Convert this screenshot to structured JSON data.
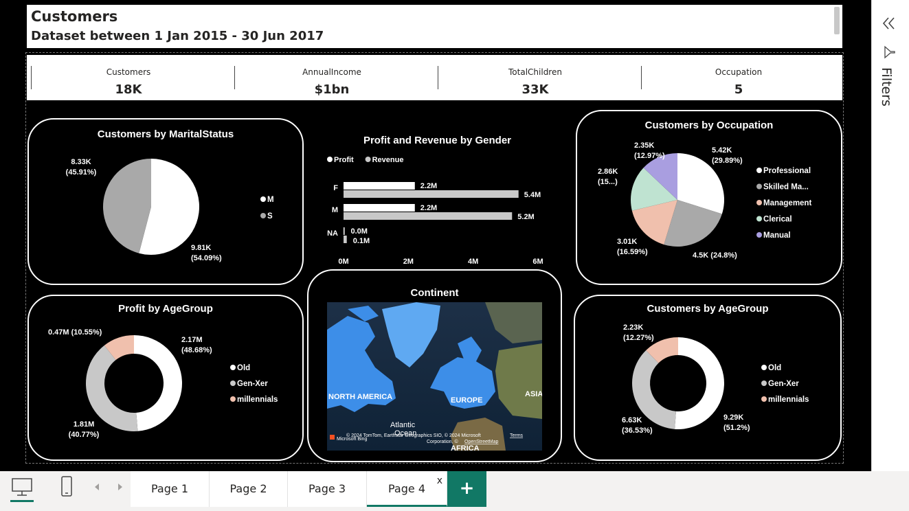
{
  "header": {
    "title": "Customers",
    "subtitle": "Dataset between 1 Jan 2015 - 30 Jun 2017"
  },
  "kpis": [
    {
      "label": "Customers",
      "value": "18K"
    },
    {
      "label": "AnnualIncome",
      "value": "$1bn"
    },
    {
      "label": "TotalChildren",
      "value": "33K"
    },
    {
      "label": "Occupation",
      "value": "5"
    }
  ],
  "filters": {
    "label": "Filters",
    "collapse_icon": "double-chevron-left-icon",
    "funnel_icon": "filter-funnel-icon"
  },
  "colors": {
    "white": "#ffffff",
    "gray": "#a9a9a9",
    "lightgray": "#c8c8c8",
    "peach": "#f0c0ad",
    "mint": "#bfe3d1",
    "lavender": "#a99ee0",
    "accent": "#117865"
  },
  "chart_data": [
    {
      "id": "marital",
      "type": "pie",
      "title": "Customers by MaritalStatus",
      "categories": [
        "M",
        "S"
      ],
      "values": [
        9810,
        8330
      ],
      "labels": [
        {
          "value": "9.81K",
          "pct": "(54.09%)"
        },
        {
          "value": "8.33K",
          "pct": "(45.91%)"
        }
      ],
      "colors": [
        "#ffffff",
        "#a9a9a9"
      ],
      "legend": "right"
    },
    {
      "id": "gender",
      "type": "bar",
      "title": "Profit and Revenue by Gender",
      "categories": [
        "F",
        "M",
        "NA"
      ],
      "series": [
        {
          "name": "Profit",
          "values": [
            2.2,
            2.2,
            0.0
          ],
          "labels": [
            "2.2M",
            "2.2M",
            "0.0M"
          ]
        },
        {
          "name": "Revenue",
          "values": [
            5.4,
            5.2,
            0.1
          ],
          "labels": [
            "5.4M",
            "5.2M",
            "0.1M"
          ]
        }
      ],
      "xticks": [
        "0M",
        "2M",
        "4M",
        "6M"
      ],
      "xlim": [
        0,
        6
      ],
      "legend": "top-left"
    },
    {
      "id": "occupation",
      "type": "pie",
      "title": "Customers by Occupation",
      "categories": [
        "Professional",
        "Skilled Ma...",
        "Management",
        "Clerical",
        "Manual"
      ],
      "values": [
        5420,
        4500,
        3010,
        2860,
        2350
      ],
      "labels": [
        {
          "value": "5.42K",
          "pct": "(29.89%)"
        },
        {
          "value": "4.5K (24.8%)",
          "pct": ""
        },
        {
          "value": "3.01K",
          "pct": "(16.59%)"
        },
        {
          "value": "2.86K",
          "pct": "(15...)"
        },
        {
          "value": "2.35K",
          "pct": "(12.97%)"
        }
      ],
      "colors": [
        "#ffffff",
        "#a9a9a9",
        "#f0c0ad",
        "#bfe3d1",
        "#a99ee0"
      ],
      "legend": "right"
    },
    {
      "id": "profit_age",
      "type": "pie",
      "title": "Profit by AgeGroup",
      "categories": [
        "Old",
        "Gen-Xer",
        "millennials"
      ],
      "values": [
        2.17,
        1.81,
        0.47
      ],
      "labels": [
        {
          "value": "2.17M",
          "pct": "(48.68%)"
        },
        {
          "value": "1.81M",
          "pct": "(40.77%)"
        },
        {
          "value": "0.47M (10.55%)",
          "pct": ""
        }
      ],
      "colors": [
        "#ffffff",
        "#c8c8c8",
        "#f0c0ad"
      ],
      "donut": true,
      "legend": "right"
    },
    {
      "id": "cust_age",
      "type": "pie",
      "title": "Customers by AgeGroup",
      "categories": [
        "Old",
        "Gen-Xer",
        "millennials"
      ],
      "values": [
        9290,
        6630,
        2230
      ],
      "labels": [
        {
          "value": "9.29K",
          "pct": "(51.2%)"
        },
        {
          "value": "6.63K",
          "pct": "(36.53%)"
        },
        {
          "value": "2.23K",
          "pct": "(12.27%)"
        }
      ],
      "colors": [
        "#ffffff",
        "#c8c8c8",
        "#f0c0ad"
      ],
      "donut": true,
      "legend": "right"
    }
  ],
  "map": {
    "title": "Continent",
    "labels": [
      "NORTH AMERICA",
      "EUROPE",
      "ASIA",
      "Atlantic",
      "Ocean",
      "AFRICA"
    ],
    "logo": "Microsoft Bing",
    "attribution": "© 2024 TomTom, Earthstar Geographics SIO, © 2024 Microsoft",
    "terms": "Terms",
    "corporation": "Corporation, ©",
    "osm": "OpenStreetMap"
  },
  "tabs": {
    "items": [
      "Page 1",
      "Page 2",
      "Page 3",
      "Page 4"
    ],
    "active": "Page 4",
    "close": "x",
    "add": "+",
    "desktop_icon": "desktop-icon",
    "mobile_icon": "mobile-icon"
  }
}
